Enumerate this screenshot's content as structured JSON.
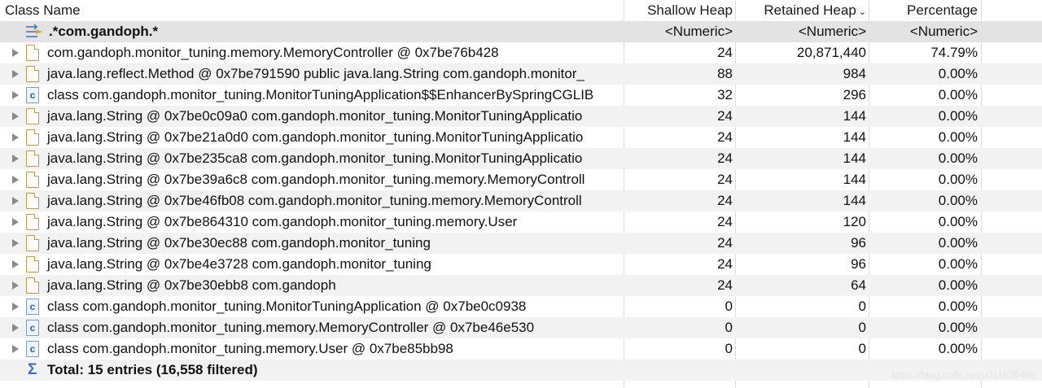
{
  "columns": {
    "name": "Class Name",
    "shallow": "Shallow Heap",
    "retained": "Retained Heap",
    "percentage": "Percentage",
    "sort_indicator": "⌄"
  },
  "filter_row": {
    "pattern": ".*com.gandoph.*",
    "shallow": "<Numeric>",
    "retained": "<Numeric>",
    "percentage": "<Numeric>"
  },
  "rows": [
    {
      "icon": "file",
      "name": "com.gandoph.monitor_tuning.memory.MemoryController @ 0x7be76b428",
      "shallow": "24",
      "retained": "20,871,440",
      "pct": "74.79%"
    },
    {
      "icon": "file",
      "name": "java.lang.reflect.Method @ 0x7be791590  public java.lang.String com.gandoph.monitor_",
      "shallow": "88",
      "retained": "984",
      "pct": "0.00%"
    },
    {
      "icon": "class",
      "name": "class com.gandoph.monitor_tuning.MonitorTuningApplication$$EnhancerBySpringCGLIB",
      "shallow": "32",
      "retained": "296",
      "pct": "0.00%"
    },
    {
      "icon": "file",
      "name": "java.lang.String @ 0x7be0c09a0  com.gandoph.monitor_tuning.MonitorTuningApplicatio",
      "shallow": "24",
      "retained": "144",
      "pct": "0.00%"
    },
    {
      "icon": "file",
      "name": "java.lang.String @ 0x7be21a0d0  com.gandoph.monitor_tuning.MonitorTuningApplicatio",
      "shallow": "24",
      "retained": "144",
      "pct": "0.00%"
    },
    {
      "icon": "file",
      "name": "java.lang.String @ 0x7be235ca8  com.gandoph.monitor_tuning.MonitorTuningApplicatio",
      "shallow": "24",
      "retained": "144",
      "pct": "0.00%"
    },
    {
      "icon": "file",
      "name": "java.lang.String @ 0x7be39a6c8  com.gandoph.monitor_tuning.memory.MemoryControll",
      "shallow": "24",
      "retained": "144",
      "pct": "0.00%"
    },
    {
      "icon": "file",
      "name": "java.lang.String @ 0x7be46fb08  com.gandoph.monitor_tuning.memory.MemoryControll",
      "shallow": "24",
      "retained": "144",
      "pct": "0.00%"
    },
    {
      "icon": "file",
      "name": "java.lang.String @ 0x7be864310  com.gandoph.monitor_tuning.memory.User",
      "shallow": "24",
      "retained": "120",
      "pct": "0.00%"
    },
    {
      "icon": "file",
      "name": "java.lang.String @ 0x7be30ec88  com.gandoph.monitor_tuning",
      "shallow": "24",
      "retained": "96",
      "pct": "0.00%"
    },
    {
      "icon": "file",
      "name": "java.lang.String @ 0x7be4e3728  com.gandoph.monitor_tuning",
      "shallow": "24",
      "retained": "96",
      "pct": "0.00%"
    },
    {
      "icon": "file",
      "name": "java.lang.String @ 0x7be30ebb8  com.gandoph",
      "shallow": "24",
      "retained": "64",
      "pct": "0.00%"
    },
    {
      "icon": "class",
      "name": "class com.gandoph.monitor_tuning.MonitorTuningApplication @ 0x7be0c0938",
      "shallow": "0",
      "retained": "0",
      "pct": "0.00%"
    },
    {
      "icon": "class",
      "name": "class com.gandoph.monitor_tuning.memory.MemoryController @ 0x7be46e530",
      "shallow": "0",
      "retained": "0",
      "pct": "0.00%"
    },
    {
      "icon": "class",
      "name": "class com.gandoph.monitor_tuning.memory.User @ 0x7be85bb98",
      "shallow": "0",
      "retained": "0",
      "pct": "0.00%"
    }
  ],
  "total": {
    "label": "Total: 15 entries (16,558 filtered)"
  },
  "watermark": "https://blog.csdn.net/u011635492",
  "icons": {
    "expand": "expand-triangle-icon",
    "file": "object-file-icon",
    "class": "class-c-icon",
    "filter": "filter-regex-icon",
    "sum": "sigma-icon"
  }
}
